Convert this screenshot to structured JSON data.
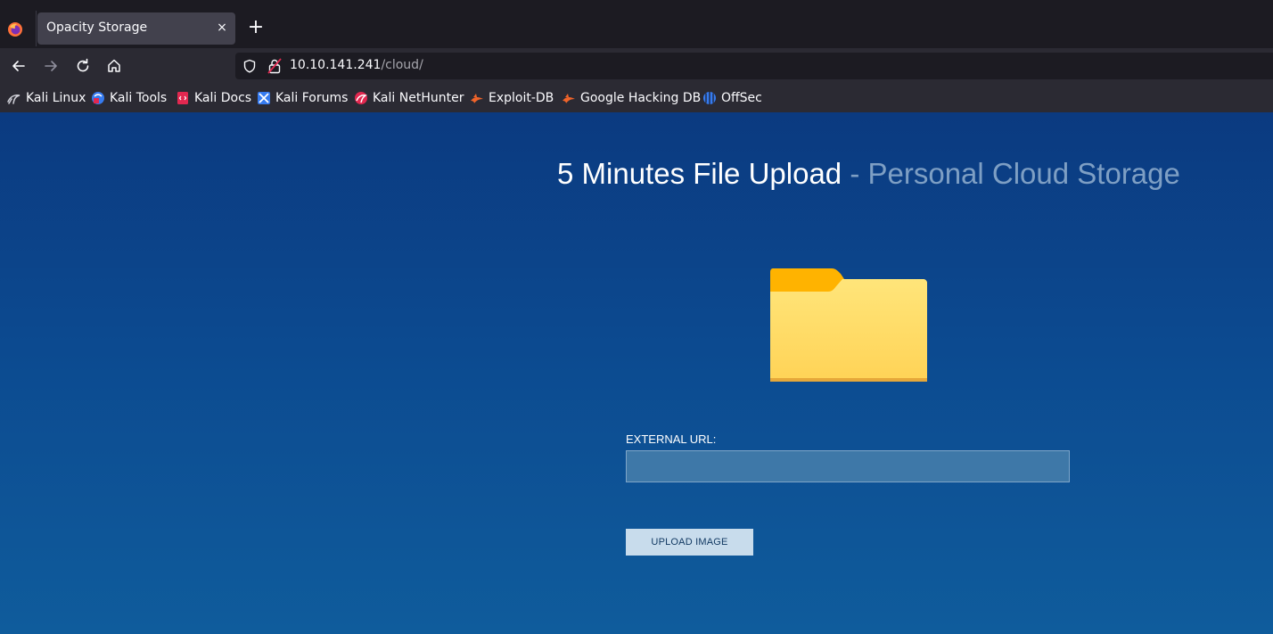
{
  "browser": {
    "tab": {
      "title": "Opacity Storage",
      "close": "×"
    },
    "new_tab": "+",
    "address": {
      "host": "10.10.141.241",
      "path": "/cloud/"
    },
    "bookmarks": [
      {
        "label": "Kali Linux",
        "icon": "kali-dragon-icon"
      },
      {
        "label": "Kali Tools",
        "icon": "kali-tools-icon"
      },
      {
        "label": "Kali Docs",
        "icon": "kali-docs-icon"
      },
      {
        "label": "Kali Forums",
        "icon": "kali-forums-icon"
      },
      {
        "label": "Kali NetHunter",
        "icon": "kali-nethunter-icon"
      },
      {
        "label": "Exploit-DB",
        "icon": "exploit-db-icon"
      },
      {
        "label": "Google Hacking DB",
        "icon": "ghdb-icon"
      },
      {
        "label": "OffSec",
        "icon": "offsec-icon"
      }
    ]
  },
  "page": {
    "title_main": "5 Minutes File Upload",
    "title_sep": " - ",
    "title_sub": "Personal Cloud Storage",
    "url_label": "EXTERNAL URL:",
    "url_value": "",
    "upload_button": "UPLOAD IMAGE"
  },
  "colors": {
    "page_gradient_top": "#0b3a80",
    "page_gradient_bottom": "#0f5c9c",
    "folder_front": "#ffd966",
    "folder_tab": "#ffb300",
    "button_bg": "#c8dcec"
  }
}
